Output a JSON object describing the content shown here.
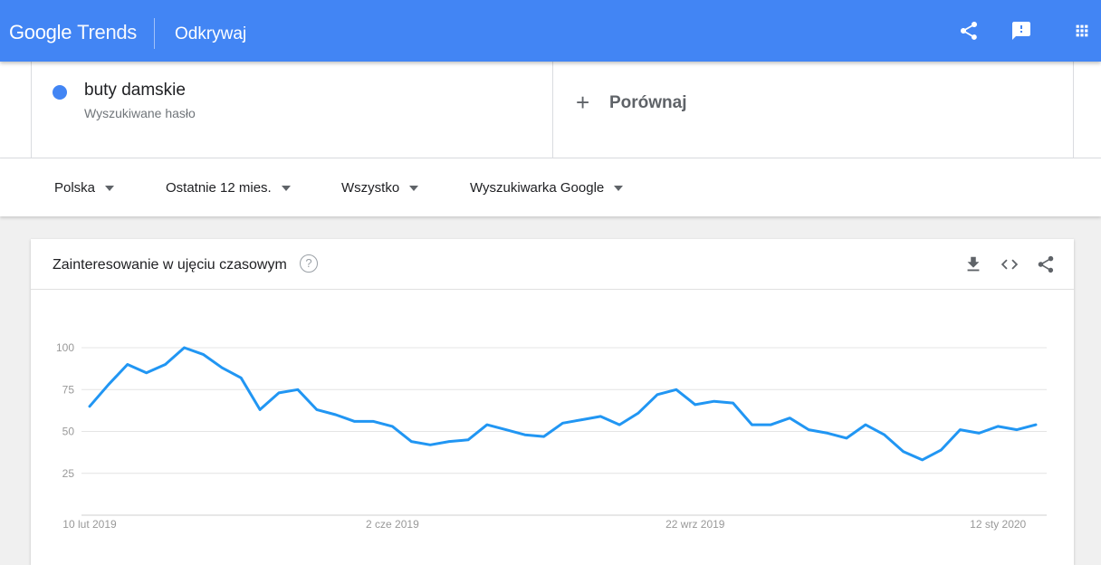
{
  "header": {
    "logo_google": "Google",
    "logo_trends": "Trends",
    "section": "Odkrywaj"
  },
  "term": {
    "name": "buty damskie",
    "type": "Wyszukiwane hasło",
    "color": "#4285f4"
  },
  "compare": {
    "label": "Porównaj"
  },
  "filters": [
    "Polska",
    "Ostatnie 12 mies.",
    "Wszystko",
    "Wyszukiwarka Google"
  ],
  "card": {
    "title": "Zainteresowanie w ujęciu czasowym",
    "help": "?"
  },
  "chart_data": {
    "type": "line",
    "title": "Zainteresowanie w ujęciu czasowym",
    "ylim": [
      0,
      100
    ],
    "yticks": [
      25,
      50,
      75,
      100
    ],
    "grid": true,
    "xtick_labels": [
      {
        "label": "10 lut 2019",
        "index": 0
      },
      {
        "label": "2 cze 2019",
        "index": 16
      },
      {
        "label": "22 wrz 2019",
        "index": 32
      },
      {
        "label": "12 sty 2020",
        "index": 48
      }
    ],
    "series": [
      {
        "color": "#2196f3",
        "values": [
          65,
          78,
          90,
          85,
          90,
          100,
          96,
          88,
          82,
          63,
          73,
          75,
          63,
          60,
          56,
          56,
          53,
          44,
          42,
          44,
          45,
          54,
          51,
          48,
          47,
          55,
          57,
          59,
          54,
          61,
          72,
          75,
          66,
          68,
          67,
          54,
          54,
          58,
          51,
          49,
          46,
          54,
          48,
          38,
          33,
          39,
          51,
          49,
          53,
          51,
          54
        ]
      }
    ]
  }
}
